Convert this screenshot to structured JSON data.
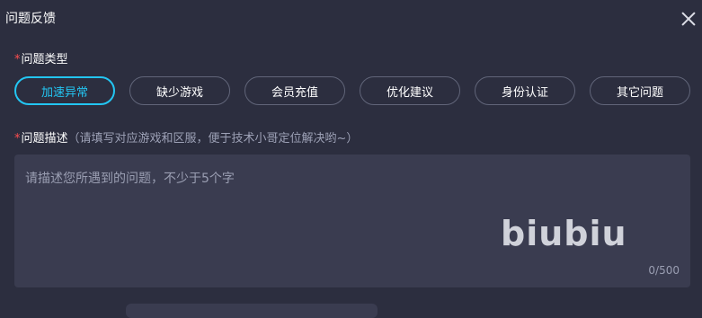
{
  "dialog": {
    "title": "问题反馈",
    "close_icon": "close-icon"
  },
  "type_section": {
    "required_mark": "*",
    "label": "问题类型",
    "options": [
      "加速异常",
      "缺少游戏",
      "会员充值",
      "优化建议",
      "身份认证",
      "其它问题"
    ],
    "selected": "加速异常",
    "accent_color": "#23c6f3"
  },
  "desc_section": {
    "required_mark": "*",
    "label": "问题描述",
    "hint": "（请填写对应游戏和区服，便于技术小哥定位解决哟~）",
    "placeholder": "请描述您所遇到的问题，不少于5个字",
    "value": "",
    "counter": "0/500",
    "watermark": "biubiu"
  },
  "colors": {
    "background": "#2c2e3f",
    "required": "#ff4d4f"
  }
}
